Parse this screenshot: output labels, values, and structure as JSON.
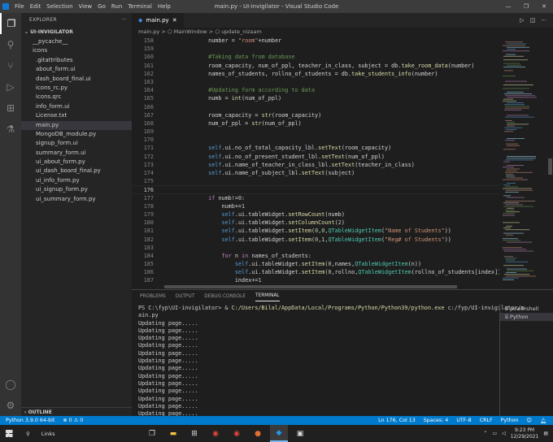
{
  "titlebar": {
    "menu": [
      "File",
      "Edit",
      "Selection",
      "View",
      "Go",
      "Run",
      "Terminal",
      "Help"
    ],
    "title": "main.py - UI-invigilator - Visual Studio Code"
  },
  "sidebar": {
    "header": "EXPLORER",
    "folder": "UI-INVIGILATOR",
    "items": [
      "__pycache__",
      "icons",
      ".gitattributes",
      "about_form.ui",
      "dash_board_final.ui",
      "icons_rc.py",
      "icons.qrc",
      "info_form.ui",
      "License.txt",
      "main.py",
      "MongoDB_module.py",
      "signup_form.ui",
      "summary_form.ui",
      "ui_about_form.py",
      "ui_dash_board_final.py",
      "ui_info_form.py",
      "ui_signup_form.py",
      "ui_summary_form.py"
    ],
    "outline": "OUTLINE"
  },
  "editor": {
    "tab_label": "main.py",
    "breadcrumb": "main.py > ⬡ MainWindow > ⬡ update_nizaam",
    "lines": [
      {
        "n": "158",
        "t": "            number = \"room\"+number"
      },
      {
        "n": "159",
        "t": ""
      },
      {
        "n": "160",
        "t": "            #Taking data from database"
      },
      {
        "n": "161",
        "t": "            room_capacity, num_of_ppl, teacher_in_class, subject = db.take_room_data(number)"
      },
      {
        "n": "162",
        "t": "            names_of_students, rollno_of_students = db.take_students_info(number)"
      },
      {
        "n": "163",
        "t": ""
      },
      {
        "n": "164",
        "t": "            #Updating form according to data"
      },
      {
        "n": "165",
        "t": "            numb = int(num_of_ppl)"
      },
      {
        "n": "166",
        "t": ""
      },
      {
        "n": "167",
        "t": "            room_capacity = str(room_capacity)"
      },
      {
        "n": "168",
        "t": "            num_of_ppl = str(num_of_ppl)"
      },
      {
        "n": "169",
        "t": ""
      },
      {
        "n": "170",
        "t": ""
      },
      {
        "n": "171",
        "t": "            self.ui.no_of_total_capacity_lbl.setText(room_capacity)"
      },
      {
        "n": "172",
        "t": "            self.ui.no_of_present_student_lbl.setText(num_of_ppl)"
      },
      {
        "n": "173",
        "t": "            self.ui.name_of_teacher_in_class_lbl.setText(teacher_in_class)"
      },
      {
        "n": "174",
        "t": "            self.ui.name_of_subject_lbl.setText(subject)"
      },
      {
        "n": "175",
        "t": ""
      },
      {
        "n": "176",
        "t": ""
      },
      {
        "n": "177",
        "t": "            if numb!=0:"
      },
      {
        "n": "178",
        "t": "                numb+=1"
      },
      {
        "n": "179",
        "t": "                self.ui.tableWidget.setRowCount(numb)"
      },
      {
        "n": "180",
        "t": "                self.ui.tableWidget.setColumnCount(2)"
      },
      {
        "n": "181",
        "t": "                self.ui.tableWidget.setItem(0,0,QTableWidgetItem(\"Name of Students\"))"
      },
      {
        "n": "182",
        "t": "                self.ui.tableWidget.setItem(0,1,QTableWidgetItem(\"Reg# of Students\"))"
      },
      {
        "n": "183",
        "t": ""
      },
      {
        "n": "184",
        "t": "                for n in names_of_students:"
      },
      {
        "n": "185",
        "t": "                    self.ui.tableWidget.setItem(0,names,QTableWidgetItem(n))"
      },
      {
        "n": "186",
        "t": "                    self.ui.tableWidget.setItem(0,rollno,QTableWidgetItem(rollno_of_students[index]))"
      },
      {
        "n": "187",
        "t": "                    index+=1"
      }
    ]
  },
  "panel": {
    "tabs": [
      "PROBLEMS",
      "OUTPUT",
      "DEBUG CONSOLE",
      "TERMINAL"
    ],
    "prompt": "PS C:\\fyp\\UI-invigilator> & ",
    "command_path": "C:/Users/Bilal/AppData/Local/Programs/Python/Python39/python.exe",
    "command_arg": " c:/fyp/UI-invigilator/m",
    "command_wrap": "ain.py",
    "output_line": "Updating page.....",
    "output_count": 13,
    "terminals": [
      "powershell",
      "Python"
    ]
  },
  "statusbar": {
    "python": "Python 3.9.0 64-bit",
    "problems": "⊗ 0 ⚠ 0",
    "position": "Ln 176, Col 13",
    "spaces": "Spaces: 4",
    "encoding": "UTF-8",
    "eol": "CRLF",
    "language": "Python"
  },
  "taskbar": {
    "search": "Links",
    "time": "9:23 PM",
    "date": "12/29/2021"
  }
}
